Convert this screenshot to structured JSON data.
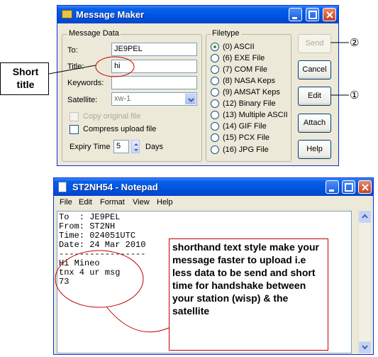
{
  "message_maker": {
    "title": "Message Maker",
    "message_data": {
      "legend": "Message Data",
      "to_label": "To:",
      "to_value": "JE9PEL",
      "title_label": "Title:",
      "title_value": "hi",
      "keywords_label": "Keywords:",
      "keywords_value": "",
      "satellite_label": "Satellite:",
      "satellite_value": "xw-1",
      "copy_original_label": "Copy original file",
      "compress_upload_label": "Compress upload file",
      "expiry_label": "Expiry Time",
      "expiry_value": "5",
      "expiry_unit": "Days"
    },
    "filetype": {
      "legend": "Filetype",
      "options": [
        "(0) ASCII",
        "(6) EXE File",
        "(7) COM File",
        "(8) NASA Keps",
        "(9) AMSAT Keps",
        "(12) Binary File",
        "(13) Multiple ASCII",
        "(14) GIF File",
        "(15) PCX File",
        "(16) JPG File"
      ],
      "selected": "(0) ASCII"
    },
    "buttons": {
      "send": "Send",
      "cancel": "Cancel",
      "edit": "Edit",
      "attach": "Attach",
      "help": "Help"
    }
  },
  "notepad": {
    "title": "ST2NH54 - Notepad",
    "menu": [
      "File",
      "Edit",
      "Format",
      "View",
      "Help"
    ],
    "lines": [
      "To  : JE9PEL",
      "From: ST2NH",
      "Time: 024051UTC",
      "Date: 24 Mar 2010",
      "-----------------",
      "Hi Mineo",
      "tnx 4 ur msg",
      "73"
    ]
  },
  "annotations": {
    "short_title": "Short title",
    "marker_send": "②",
    "marker_edit": "①",
    "note": "shorthand text style make your message faster to upload i.e less data to be send and short time for handshake between your station (wisp) & the satellite"
  },
  "colors": {
    "xp_title_blue": "#0054e3",
    "window_face": "#ece9d8",
    "annotation_red": "#c00000",
    "radio_dot_green": "#2b9c2b"
  }
}
